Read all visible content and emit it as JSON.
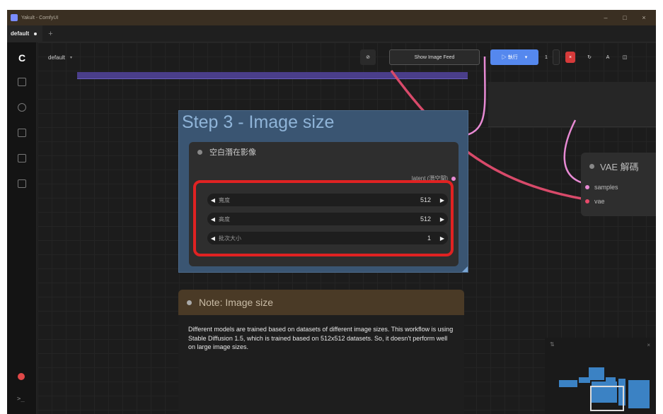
{
  "window": {
    "title": "Yakult - ComfyUI",
    "minimize": "–",
    "maximize": "□",
    "close": "×"
  },
  "tabs": [
    {
      "label": "default"
    }
  ],
  "tab_add": "+",
  "sidebar": {
    "logo": "C",
    "icons": [
      "image-icon",
      "search-icon",
      "settings-icon",
      "node-library-icon",
      "model-library-icon"
    ],
    "terminal": ">_"
  },
  "toolbar": {
    "workflow_name": "default",
    "chevron": "▾",
    "link_icon": "⊘",
    "image_feed": "Show Image Feed",
    "queue_label": "▷ 執行",
    "queue_chevron": "▾",
    "batch_count": "1",
    "stop": "×",
    "undo": "↻",
    "user": "A",
    "panel": "◫"
  },
  "group": {
    "title": "Step 3 - Image size",
    "node": {
      "title": "空白潛在影像",
      "output_label": "latent (潛空間)",
      "widgets": [
        {
          "label": "寬度",
          "value": "512"
        },
        {
          "label": "高度",
          "value": "512"
        },
        {
          "label": "批次大小",
          "value": "1"
        }
      ]
    }
  },
  "note": {
    "title": "Note: Image size",
    "body": "Different models are trained based on datasets of different image sizes. This workflow is using Stable Diffusion 1.5, which is trained based on 512x512 datasets. So, it doesn't perform well on large image sizes."
  },
  "vae_node": {
    "title": "VAE 解碼",
    "inputs": [
      "samples",
      "vae"
    ]
  },
  "minimap": {
    "icon": "⇅",
    "close": "×"
  },
  "colors": {
    "group_bg": "#3a5572",
    "highlight": "#e02222",
    "link_pink": "#e88ad4",
    "link_red": "#d84a6a",
    "queue_blue": "#5588ee"
  }
}
